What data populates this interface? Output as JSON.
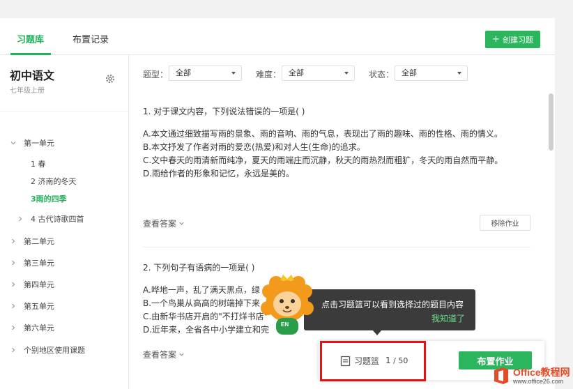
{
  "tabs": [
    "习题库",
    "布置记录"
  ],
  "create_button": "创建习题",
  "sidebar": {
    "book_title": "初中语文",
    "book_subtitle": "七年级上册",
    "tree": [
      {
        "label": "第一单元",
        "expanded": true
      },
      {
        "label": "1 春"
      },
      {
        "label": "2 济南的冬天"
      },
      {
        "label": "3雨的四季",
        "active": true
      },
      {
        "label": "4 古代诗歌四首"
      },
      {
        "label": "第二单元"
      },
      {
        "label": "第三单元"
      },
      {
        "label": "第四单元"
      },
      {
        "label": "第五单元"
      },
      {
        "label": "第六单元"
      },
      {
        "label": "个别地区使用课题"
      }
    ]
  },
  "filters": {
    "type_label": "题型：",
    "type_value": "全部",
    "difficulty_label": "难度：",
    "difficulty_value": "全部",
    "status_label": "状态：",
    "status_value": "全部"
  },
  "questions": [
    {
      "title": "1. 对于课文内容，下列说法错误的一项是(    )",
      "options": [
        "A.本文通过细致描写雨的景象、雨的音响、雨的气息，表现出了雨的趣味、雨的性格、雨的情义。",
        "B.本文抒发了作者对雨的爱恋(热爱)和对人生(生命)的追求。",
        "C.文中春天的雨清新而纯净，夏天的雨端庄而沉静，秋天的雨热烈而粗犷，冬天的雨自然而平静。",
        "D.雨给作者的形象和记忆，永远是美的。"
      ],
      "view_answer": "查看答案",
      "remove": "移除作业"
    },
    {
      "title": "2. 下列句子有语病的一项是(    )",
      "options": [
        "A.哗地一声，乱了满天黑点，绿",
        "B.一个鸟巢从高高的树端掉下来",
        "C.由新华书店开启的\"不打烊书店\"",
        "D.近年来，全省各中小学建立和完"
      ],
      "view_answer": "查看答案"
    }
  ],
  "tooltip": {
    "text": "点击习题篮可以看到选择过的题目内容",
    "confirm": "我知道了"
  },
  "basket": {
    "label": "习题篮",
    "count": "1",
    "total": "/ 50",
    "assign": "布置作业"
  },
  "mascot_badge": "EN",
  "watermark": {
    "main": "Office教程网",
    "url": "www.office26.com"
  },
  "colors": {
    "accent": "#20b15a",
    "highlight": "#e81010",
    "tooltip_bg": "#3b3b3b"
  }
}
